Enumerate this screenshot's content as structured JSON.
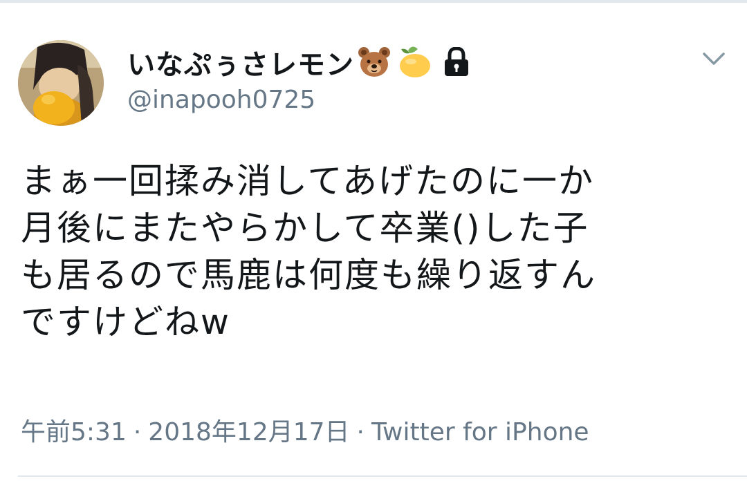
{
  "tweet": {
    "author": {
      "display_name": "いなぷぅさレモン",
      "name_emojis": [
        "bear-face-icon",
        "lemon-icon",
        "lock-icon"
      ],
      "handle": "@inapooh0725",
      "protected": true
    },
    "text_lines": [
      "まぁ一回揉み消してあげたのに一か",
      "月後にまたやらかして卒業()した子",
      "も居るので馬鹿は何度も繰り返すん",
      "ですけどねw"
    ],
    "time": "午前5:31",
    "date": "2018年12月17日",
    "separator": "·",
    "source": "Twitter for iPhone",
    "menu_icon": "chevron-down-icon"
  },
  "colors": {
    "text": "#14171a",
    "secondary": "#657786",
    "divider": "#e1e8ed"
  }
}
